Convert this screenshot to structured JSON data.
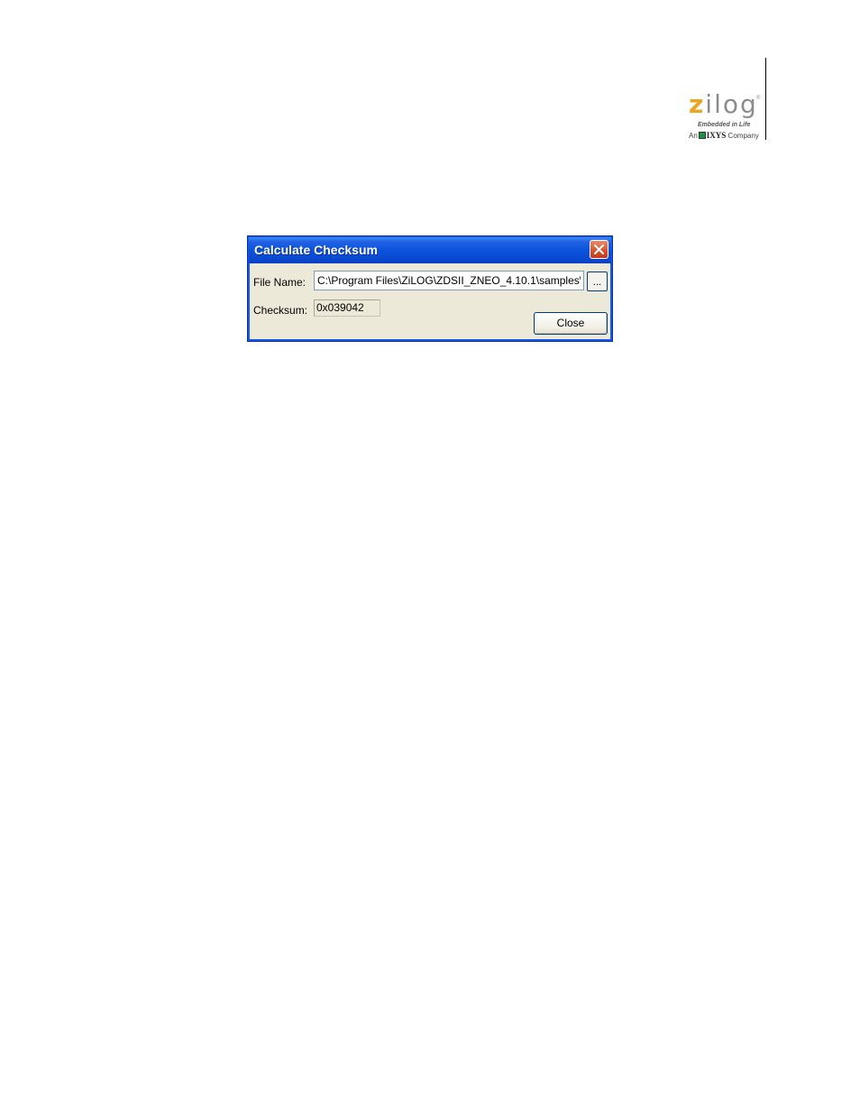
{
  "header": {
    "logo": {
      "wordmark_first": "z",
      "wordmark_rest": "ilog",
      "trademark": "®",
      "tagline": "Embedded in Life",
      "company_prefix": "An",
      "company_name": "IXYS",
      "company_suffix": "Company",
      "accent_color": "#e8a623"
    }
  },
  "dialog": {
    "title": "Calculate Checksum",
    "close_icon": "close-icon",
    "file_name_label": "File Name:",
    "file_name_value": "C:\\Program Files\\ZiLOG\\ZDSII_ZNEO_4.10.1\\samples\\",
    "browse_label": "...",
    "checksum_label": "Checksum:",
    "checksum_value": "0x039042",
    "close_button_label": "Close"
  }
}
